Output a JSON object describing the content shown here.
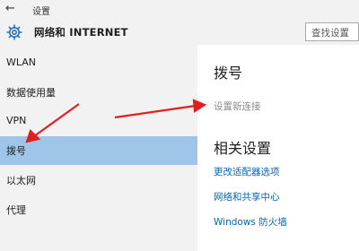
{
  "window": {
    "title": "设置"
  },
  "header": {
    "title": "网络和 INTERNET",
    "search_placeholder": "查找设置"
  },
  "sidebar": {
    "items": [
      {
        "label": "WLAN",
        "selected": false
      },
      {
        "label": "数据使用量",
        "selected": false
      },
      {
        "label": "VPN",
        "selected": false
      },
      {
        "label": "拨号",
        "selected": true
      },
      {
        "label": "以太网",
        "selected": false
      },
      {
        "label": "代理",
        "selected": false
      }
    ]
  },
  "main": {
    "heading": "拨号",
    "new_connection": "设置新连接",
    "related_heading": "相关设置",
    "related_links": [
      "更改适配器选项",
      "网络和共享中心",
      "Windows 防火墙"
    ]
  },
  "colors": {
    "selected_bg": "#9fc5e8",
    "link": "#0067b8",
    "annotation_arrow": "#e02020"
  }
}
